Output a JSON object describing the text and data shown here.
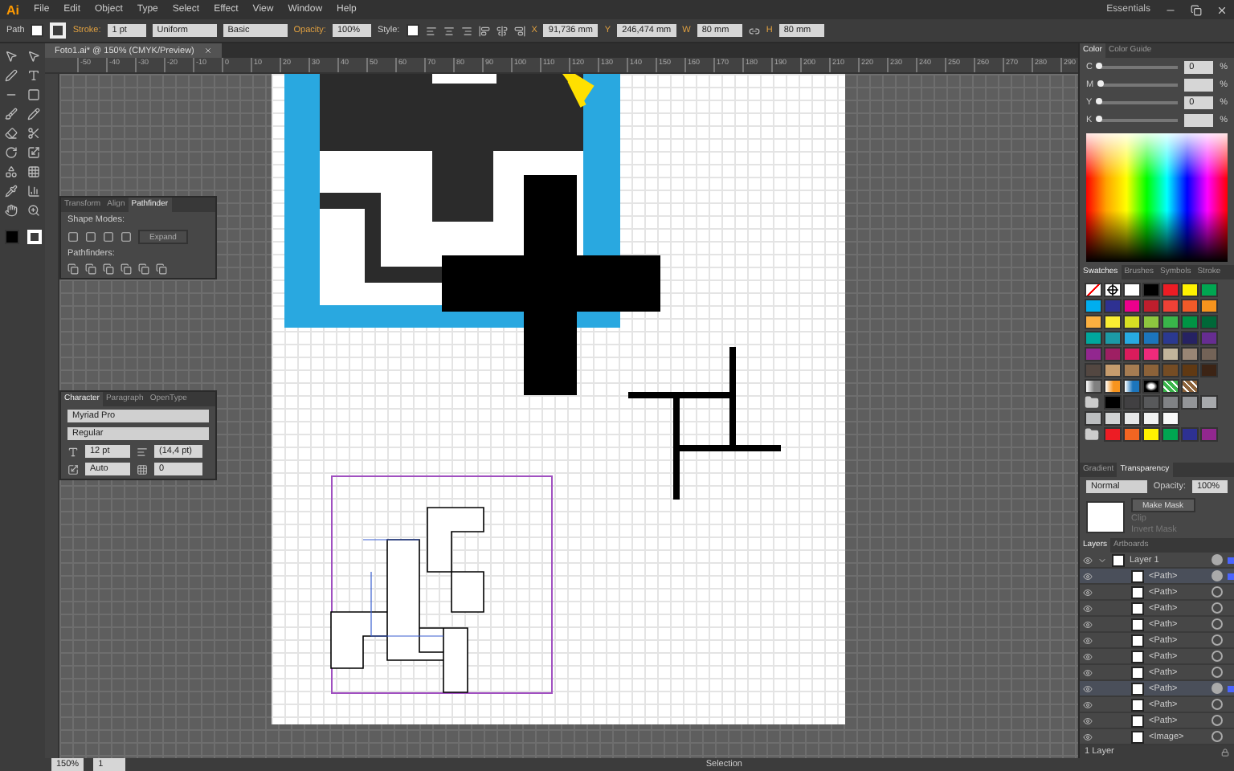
{
  "menubar": {
    "logo": "Ai",
    "menus": [
      "File",
      "Edit",
      "Object",
      "Type",
      "Select",
      "Effect",
      "View",
      "Window",
      "Help"
    ],
    "workspace": "Essentials"
  },
  "control_bar": {
    "selection": "Path",
    "stroke_label": "Stroke:",
    "stroke_weight": "1 pt",
    "profile": "Uniform",
    "brush": "Basic",
    "opacity_label": "Opacity:",
    "opacity": "100%",
    "style_label": "Style:",
    "x_label": "X",
    "x": "91,736 mm",
    "y_label": "Y",
    "w_label": "W",
    "h_label": "H",
    "y": "246,474 mm",
    "width": "80 mm",
    "height": "80 mm"
  },
  "document_tab": {
    "title": "Foto1.ai* @ 150% (CMYK/Preview)",
    "selected": true
  },
  "ruler_labels": [
    "-50",
    "-40",
    "-30",
    "-20",
    "-10",
    "0",
    "10",
    "20",
    "30",
    "40",
    "50",
    "60",
    "70",
    "80",
    "90",
    "100",
    "110",
    "120",
    "130",
    "140",
    "150",
    "160",
    "170",
    "180",
    "190",
    "200",
    "210",
    "220",
    "230",
    "240",
    "250",
    "260",
    "270",
    "280",
    "290"
  ],
  "pathfinder_panel": {
    "tabs": [
      {
        "label": "Transform",
        "selected": false
      },
      {
        "label": "Align",
        "selected": false
      },
      {
        "label": "Pathfinder",
        "selected": true
      }
    ],
    "shape_modes_label": "Shape Modes:",
    "expand_button": "Expand",
    "pathfinders_label": "Pathfinders:"
  },
  "character_panel": {
    "tabs": [
      {
        "label": "Character",
        "selected": true
      },
      {
        "label": "Paragraph",
        "selected": false
      },
      {
        "label": "OpenType",
        "selected": false
      }
    ],
    "font": "Myriad Pro",
    "style": "Regular",
    "size": "12 pt",
    "leading": "(14,4 pt)",
    "kerning": "Auto",
    "tracking": "0"
  },
  "color_panel": {
    "tabs": [
      {
        "label": "Color",
        "selected": true
      },
      {
        "label": "Color Guide",
        "selected": false
      }
    ],
    "channels": [
      {
        "label": "C",
        "value": "0",
        "unit": "%",
        "level": 0
      },
      {
        "label": "M",
        "unit": "%",
        "level": 0
      },
      {
        "label": "Y",
        "value": "0",
        "unit": "%",
        "level": 0
      },
      {
        "label": "K",
        "unit": "%",
        "level": 0
      }
    ]
  },
  "swatches_panel": {
    "tabs": [
      {
        "label": "Swatches",
        "selected": true
      },
      {
        "label": "Brushes",
        "selected": false
      },
      {
        "label": "Symbols",
        "selected": false
      },
      {
        "label": "Stroke",
        "selected": false
      }
    ],
    "swatches": [
      {
        "kind": "none"
      },
      {
        "kind": "registration"
      },
      {
        "kind": "color",
        "color": "#ffffff"
      },
      {
        "kind": "color",
        "color": "#000000"
      },
      {
        "kind": "color",
        "color": "#ed1c24"
      },
      {
        "kind": "color",
        "color": "#fff200"
      },
      {
        "kind": "color",
        "color": "#00a651"
      },
      {
        "kind": "color",
        "color": "#00aeef"
      },
      {
        "kind": "color",
        "color": "#2e3192"
      },
      {
        "kind": "color",
        "color": "#ec008c"
      },
      {
        "kind": "color",
        "color": "#be1e2d"
      },
      {
        "kind": "color",
        "color": "#ef4136"
      },
      {
        "kind": "color",
        "color": "#f15a29"
      },
      {
        "kind": "color",
        "color": "#f7941d"
      },
      {
        "kind": "color",
        "color": "#fbb040"
      },
      {
        "kind": "color",
        "color": "#f9ed32"
      },
      {
        "kind": "color",
        "color": "#d7df23"
      },
      {
        "kind": "color",
        "color": "#8dc63f"
      },
      {
        "kind": "color",
        "color": "#39b54a"
      },
      {
        "kind": "color",
        "color": "#009444"
      },
      {
        "kind": "color",
        "color": "#006838"
      },
      {
        "kind": "color",
        "color": "#00a79d"
      },
      {
        "kind": "color",
        "color": "#1c9aa6"
      },
      {
        "kind": "color",
        "color": "#27aae1"
      },
      {
        "kind": "color",
        "color": "#1c75bc"
      },
      {
        "kind": "color",
        "color": "#2b3990"
      },
      {
        "kind": "color",
        "color": "#262262"
      },
      {
        "kind": "color",
        "color": "#662d91"
      },
      {
        "kind": "color",
        "color": "#92278f"
      },
      {
        "kind": "color",
        "color": "#9e1f63"
      },
      {
        "kind": "color",
        "color": "#da1c5c"
      },
      {
        "kind": "color",
        "color": "#ee2a7b"
      },
      {
        "kind": "color",
        "color": "#c2b59b"
      },
      {
        "kind": "color",
        "color": "#998675"
      },
      {
        "kind": "color",
        "color": "#736357"
      },
      {
        "kind": "color",
        "color": "#534741"
      },
      {
        "kind": "color",
        "color": "#c69c6d"
      },
      {
        "kind": "color",
        "color": "#a67c52"
      },
      {
        "kind": "color",
        "color": "#8c6239"
      },
      {
        "kind": "color",
        "color": "#754c24"
      },
      {
        "kind": "color",
        "color": "#603913"
      },
      {
        "kind": "color",
        "color": "#3c2415"
      },
      {
        "kind": "gradient",
        "color": "#808080"
      },
      {
        "kind": "gradient",
        "color": "#f7941d"
      },
      {
        "kind": "gradient",
        "color": "#1c75bc"
      },
      {
        "kind": "radial",
        "color": "#000000"
      },
      {
        "kind": "pattern",
        "color": "#39b54a"
      },
      {
        "kind": "pattern",
        "color": "#8c6239"
      },
      {
        "kind": "empty"
      },
      {
        "kind": "folder"
      },
      {
        "kind": "color",
        "color": "#000000"
      },
      {
        "kind": "color",
        "color": "#414042"
      },
      {
        "kind": "color",
        "color": "#58595b"
      },
      {
        "kind": "color",
        "color": "#808285"
      },
      {
        "kind": "color",
        "color": "#939598"
      },
      {
        "kind": "color",
        "color": "#a7a9ac"
      },
      {
        "kind": "color",
        "color": "#bcbec0"
      },
      {
        "kind": "color",
        "color": "#d1d3d4"
      },
      {
        "kind": "color",
        "color": "#e6e7e8"
      },
      {
        "kind": "color",
        "color": "#f1f2f2"
      },
      {
        "kind": "color",
        "color": "#f8f8f8"
      },
      {
        "kind": "empty"
      },
      {
        "kind": "empty"
      },
      {
        "kind": "folder"
      },
      {
        "kind": "color",
        "color": "#ed1c24"
      },
      {
        "kind": "color",
        "color": "#f26522"
      },
      {
        "kind": "color",
        "color": "#fff200"
      },
      {
        "kind": "color",
        "color": "#00a651"
      },
      {
        "kind": "color",
        "color": "#2e3192"
      },
      {
        "kind": "color",
        "color": "#92278f"
      }
    ]
  },
  "transparency_panel": {
    "tabs": [
      {
        "label": "Gradient",
        "selected": false
      },
      {
        "label": "Transparency",
        "selected": true
      }
    ],
    "blend_mode": "Normal",
    "opacity_label": "Opacity:",
    "opacity": "100%",
    "make_mask_button": "Make Mask",
    "clip": {
      "label": "Clip",
      "disabled": true
    },
    "invert_mask": {
      "label": "Invert Mask",
      "disabled": true
    }
  },
  "layers_panel": {
    "tabs": [
      {
        "label": "Layers",
        "selected": true
      },
      {
        "label": "Artboards",
        "selected": false
      }
    ],
    "layers": [
      {
        "name": "Layer 1",
        "expanded": true,
        "selected": true,
        "children": [
          {
            "name": "<Path>",
            "selected": true
          },
          {
            "name": "<Path>",
            "selected": false
          },
          {
            "name": "<Path>",
            "selected": false
          },
          {
            "name": "<Path>",
            "selected": false
          },
          {
            "name": "<Path>",
            "selected": false
          },
          {
            "name": "<Path>",
            "selected": false
          },
          {
            "name": "<Path>",
            "selected": false
          },
          {
            "name": "<Path>",
            "selected": true
          },
          {
            "name": "<Path>",
            "selected": false
          },
          {
            "name": "<Path>",
            "selected": false
          },
          {
            "name": "<Image>",
            "selected": false
          }
        ]
      }
    ],
    "count": "1 Layer"
  },
  "status_bar": {
    "zoom": "150%",
    "artboard": "1",
    "tool": "Selection"
  }
}
